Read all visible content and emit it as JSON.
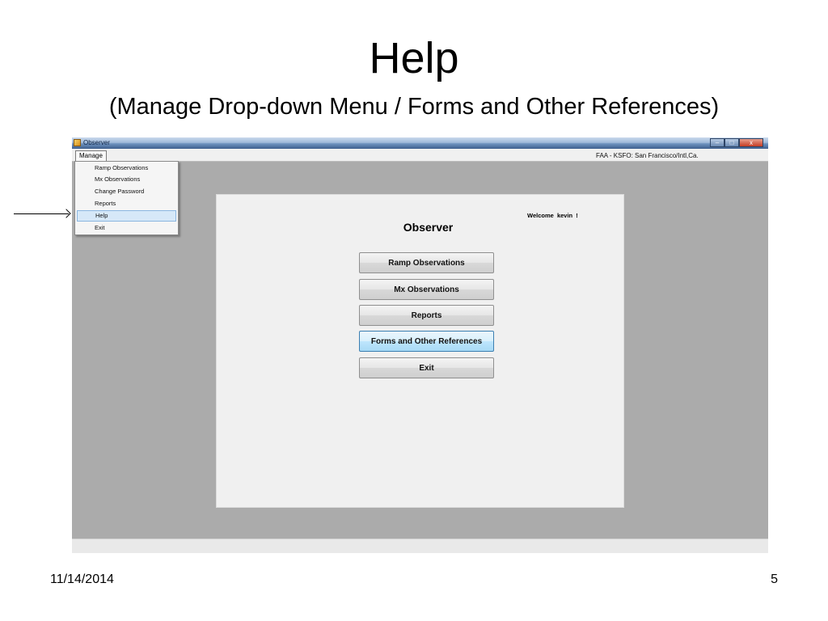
{
  "slide": {
    "title": "Help",
    "subtitle": "(Manage Drop-down Menu / Forms and Other References)",
    "date": "11/14/2014",
    "page_number": "5"
  },
  "window": {
    "title": "Observer",
    "controls": {
      "minimize": "–",
      "maximize": "□",
      "close": "x"
    }
  },
  "menubar": {
    "manage_label": "Manage",
    "location_label": "FAA - KSFO: San Francisco/Intl,Ca."
  },
  "dropdown": {
    "items": [
      {
        "label": "Ramp Observations"
      },
      {
        "label": "Mx Observations"
      },
      {
        "label": "Change Password"
      },
      {
        "label": "Reports"
      },
      {
        "label": "Help",
        "highlighted": true
      },
      {
        "label": "Exit"
      }
    ]
  },
  "panel": {
    "welcome": "Welcome  kevin  !",
    "heading": "Observer",
    "buttons": [
      {
        "label": "Ramp Observations"
      },
      {
        "label": "Mx Observations"
      },
      {
        "label": "Reports"
      },
      {
        "label": "Forms and Other References",
        "focused": true
      },
      {
        "label": "Exit"
      }
    ]
  }
}
